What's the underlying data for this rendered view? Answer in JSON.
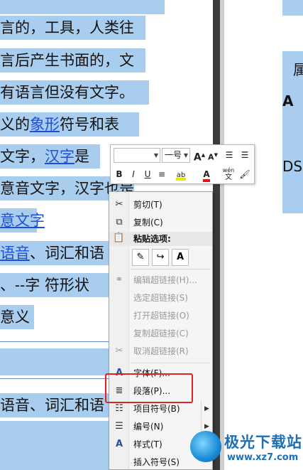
{
  "document": {
    "lines": [
      "言的，工具，人类往",
      "言后产生书面的，文",
      "有语言但没有文字。",
      "义的",
      "象形",
      "符号和表",
      "文字，",
      "汉字",
      "是",
      "意音文字，汉字也是",
      "意文字",
      "语音",
      "、词汇和语",
      "、--字  符形状",
      "意义",
      "语音",
      "、词汇和语"
    ],
    "right_page": {
      "line1": "属",
      "line2": "A",
      "line3": "DS"
    }
  },
  "mini_toolbar": {
    "font_name": "",
    "font_size": "一号",
    "grow_font": "A",
    "shrink_font": "A",
    "bold": "B",
    "italic": "I",
    "underline": "U",
    "font_color": "A",
    "phonetic": "wén"
  },
  "context_menu": {
    "items": [
      {
        "label": "剪切(T)",
        "icon": "scissors-icon",
        "enabled": true
      },
      {
        "label": "复制(C)",
        "icon": "copy-icon",
        "enabled": true
      },
      {
        "label": "粘贴选项:",
        "icon": "paste-icon",
        "enabled": true
      },
      {
        "label": "编辑超链接(H)...",
        "icon": "link-icon",
        "enabled": false
      },
      {
        "label": "选定超链接(S)",
        "icon": "",
        "enabled": false
      },
      {
        "label": "打开超链接(O)",
        "icon": "",
        "enabled": false
      },
      {
        "label": "复制超链接(C)",
        "icon": "",
        "enabled": false
      },
      {
        "label": "取消超链接(R)",
        "icon": "unlink-icon",
        "enabled": false
      },
      {
        "label": "字体(F)...",
        "icon": "font-icon",
        "enabled": true
      },
      {
        "label": "段落(P)...",
        "icon": "paragraph-icon",
        "enabled": true
      },
      {
        "label": "项目符号(B)",
        "icon": "bullets-icon",
        "enabled": true
      },
      {
        "label": "编号(N)",
        "icon": "numbering-icon",
        "enabled": true
      },
      {
        "label": "样式(T)",
        "icon": "styles-icon",
        "enabled": true
      },
      {
        "label": "插入符号(S)",
        "icon": "",
        "enabled": true
      }
    ],
    "paste_options": [
      "keep-source",
      "merge",
      "text-only"
    ],
    "paste_text_only_label": "A"
  },
  "watermark": {
    "name": "极光下载站",
    "url": "www.xz7.com"
  },
  "colors": {
    "selection": "#a9cdee",
    "highlight": "#e0231f",
    "link": "#1f4fd6"
  }
}
